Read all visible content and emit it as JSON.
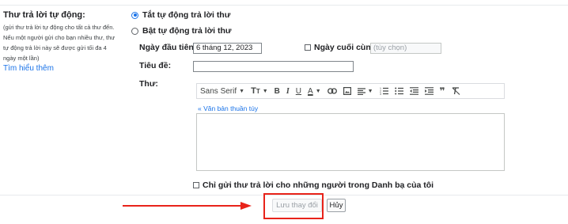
{
  "vacation": {
    "title": "Thư trả lời tự động:",
    "description_lines": [
      "(gửi thư trả lời tự động cho tất cả thư đến.",
      "Nếu một người gửi cho bạn nhiều thư, thư",
      "tự động trả lời này sẽ được gửi tối đa 4",
      "ngày một lần)"
    ],
    "learn_more": "Tìm hiểu thêm",
    "option_off": "Tắt tự động trả lời thư",
    "option_on": "Bật tự động trả lời thư",
    "selected_option": "off",
    "first_day_label": "Ngày đầu tiên:",
    "first_day_value": "6 tháng 12, 2023",
    "last_day_label": "Ngày cuối cùng:",
    "last_day_placeholder": "(tùy chọn)",
    "subject_label": "Tiêu đề:",
    "subject_value": "",
    "message_label": "Thư:",
    "plain_text_link": "« Văn bản thuần túy",
    "contacts_only_label": "Chỉ gửi thư trả lời cho những người trong Danh bạ của tôi"
  },
  "toolbar": {
    "font": "Sans Serif",
    "size_icon": "text-size-icon",
    "bold": "B",
    "italic": "I",
    "underline": "U",
    "text_color": "A",
    "icons": [
      "link-icon",
      "image-icon",
      "align-icon",
      "numbered-list-icon",
      "bulleted-list-icon",
      "indent-less-icon",
      "indent-more-icon",
      "quote-icon",
      "remove-formatting-icon"
    ]
  },
  "buttons": {
    "save": "Lưu thay đổi",
    "cancel": "Hủy"
  },
  "colors": {
    "accent": "#1a73e8",
    "annotation": "#e8231a"
  }
}
